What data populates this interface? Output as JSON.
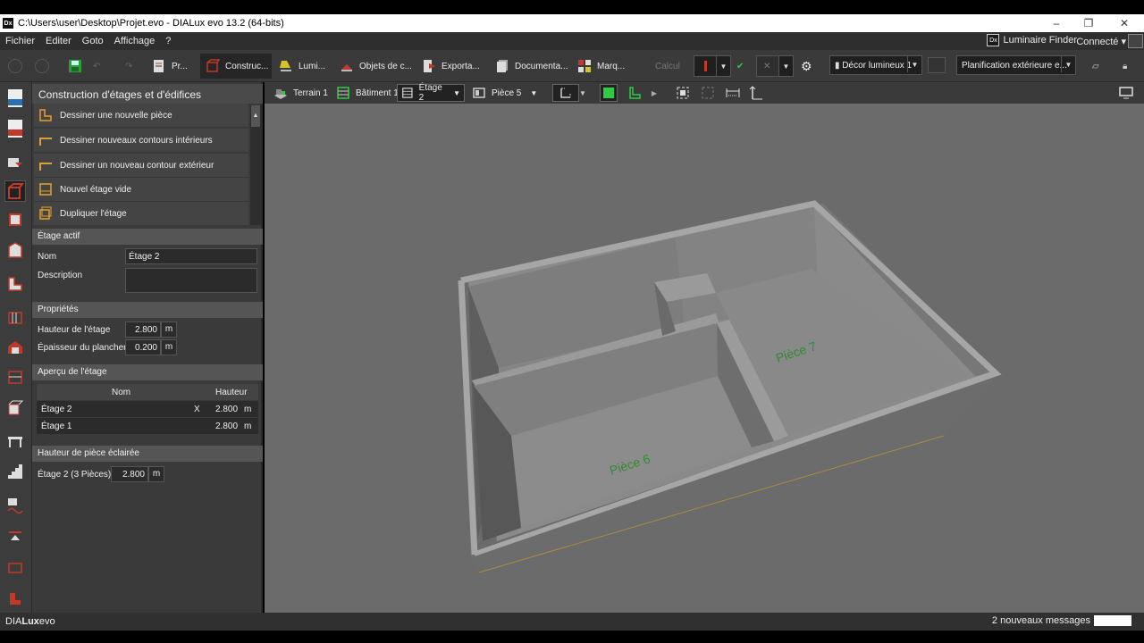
{
  "window": {
    "app_icon": "Dx",
    "title": "C:\\Users\\user\\Desktop\\Projet.evo - DIALux evo 13.2  (64-bits)",
    "minimize_icon": "–",
    "restore_icon": "❐",
    "close_icon": "✕"
  },
  "menu": {
    "items": [
      "Fichier",
      "Editer",
      "Goto",
      "Affichage",
      "?"
    ],
    "luminaire_finder": "Luminaire Finder",
    "connected": "Connecté"
  },
  "toolbar": {
    "tabs": [
      "Pr...",
      "Construc...",
      "Lumi...",
      "Objets de c...",
      "Exporta...",
      "Documenta...",
      "Marq..."
    ],
    "calc": "Calcul",
    "decor": "Décor lumineux 1",
    "planning": "Planification extérieure e..."
  },
  "panel": {
    "title": "Construction d'étages et d'édifices",
    "actions": [
      "Dessiner une nouvelle pièce",
      "Dessiner nouveaux contours intérieurs",
      "Dessiner un nouveau contour extérieur",
      "Nouvel étage vide",
      "Dupliquer l'étage"
    ],
    "active_floor": {
      "section": "Étage actif",
      "name_label": "Nom",
      "name_value": "Étage 2",
      "description_label": "Description"
    },
    "properties": {
      "section": "Propriétés",
      "height_label": "Hauteur de l'étage",
      "height_value": "2.800",
      "thickness_label": "Épaisseur du plancher",
      "thickness_value": "0.200",
      "unit": "m"
    },
    "overview": {
      "section": "Aperçu de l'étage",
      "col_name": "Nom",
      "col_height": "Hauteur",
      "rows": [
        {
          "name": "Étage 2",
          "mark": "X",
          "height": "2.800",
          "unit": "m"
        },
        {
          "name": "Étage 1",
          "mark": "",
          "height": "2.800",
          "unit": "m"
        }
      ]
    },
    "lit_room": {
      "section": "Hauteur de pièce éclairée",
      "label": "Étage 2 (3 Pièces)",
      "value": "2.800",
      "unit": "m"
    }
  },
  "viewport": {
    "breadcrumbs": [
      "Terrain 1",
      "Bâtiment 1",
      "Étage 2",
      "Pièce 5"
    ],
    "rooms": [
      "Pièce 6",
      "Pièce 7"
    ]
  },
  "status": {
    "brand_a": "DIA",
    "brand_b": "Lux",
    "brand_c": "evo",
    "messages": "2 nouveaux messages"
  },
  "colors": {
    "accent_red": "#c0392b",
    "room_label_green": "#2e8b2e",
    "highlight_green": "#2ecc40"
  }
}
